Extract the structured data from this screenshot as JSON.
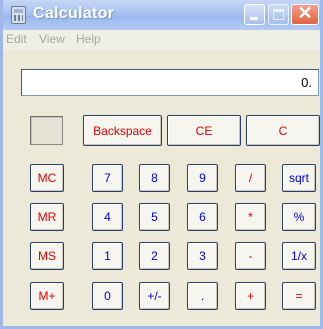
{
  "window": {
    "title": "Calculator",
    "controls": {
      "minimize": "minimize",
      "maximize": "maximize",
      "close": "✕"
    }
  },
  "menu": {
    "items": [
      "Edit",
      "View",
      "Help"
    ]
  },
  "display": {
    "value": "0."
  },
  "colors": {
    "red_text": "#e00000",
    "blue_text": "#0000d8",
    "title_bar": "#a9c2f1",
    "close_button": "#e06444"
  },
  "keys": {
    "backspace": "Backspace",
    "ce": "CE",
    "c": "C",
    "mc": "MC",
    "mr": "MR",
    "ms": "MS",
    "mplus": "M+",
    "d7": "7",
    "d8": "8",
    "d9": "9",
    "divide": "/",
    "sqrt": "sqrt",
    "d4": "4",
    "d5": "5",
    "d6": "6",
    "multiply": "*",
    "percent": "%",
    "d1": "1",
    "d2": "2",
    "d3": "3",
    "minus": "-",
    "reciprocal": "1/x",
    "d0": "0",
    "sign": "+/-",
    "dot": ".",
    "plus": "+",
    "equals": "="
  }
}
